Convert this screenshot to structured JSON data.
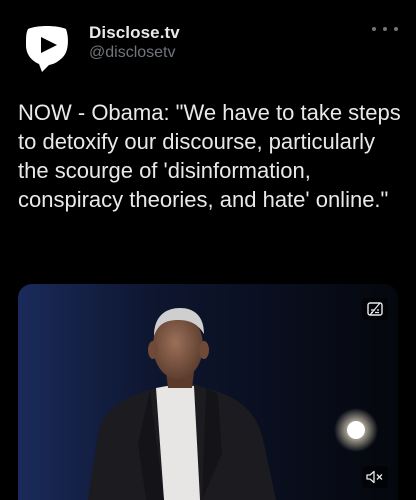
{
  "account": {
    "display_name": "Disclose.tv",
    "handle": "@disclosetv",
    "avatar_icon": "disclose-logo-icon"
  },
  "tweet": {
    "text": "NOW - Obama: \"We have to take steps to detoxify our discourse, particularly the scourge of 'disinformation, conspiracy theories, and hate' online.\""
  },
  "media": {
    "type": "video",
    "caption_icon": "captions-icon",
    "volume_icon": "volume-muted-icon"
  },
  "menu": {
    "icon": "more-options-icon"
  },
  "colors": {
    "background": "#000000",
    "primary_text": "#e7e9ea",
    "secondary_text": "#71767b"
  }
}
